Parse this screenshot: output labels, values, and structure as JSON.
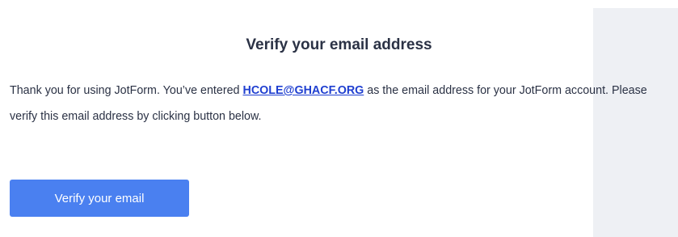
{
  "email": {
    "title": "Verify your email address",
    "body_part1": "Thank you for using JotForm. You’ve entered ",
    "email_address": "HCOLE@GHACF.ORG",
    "body_part2": " as the email address for your JotForm account. Please verify this email address by clicking button below.",
    "button_label": "Verify your email"
  },
  "colors": {
    "button_bg": "#4a80f0",
    "link": "#1f3fd0",
    "text": "#2b3245",
    "side_panel": "#eef0f4"
  }
}
